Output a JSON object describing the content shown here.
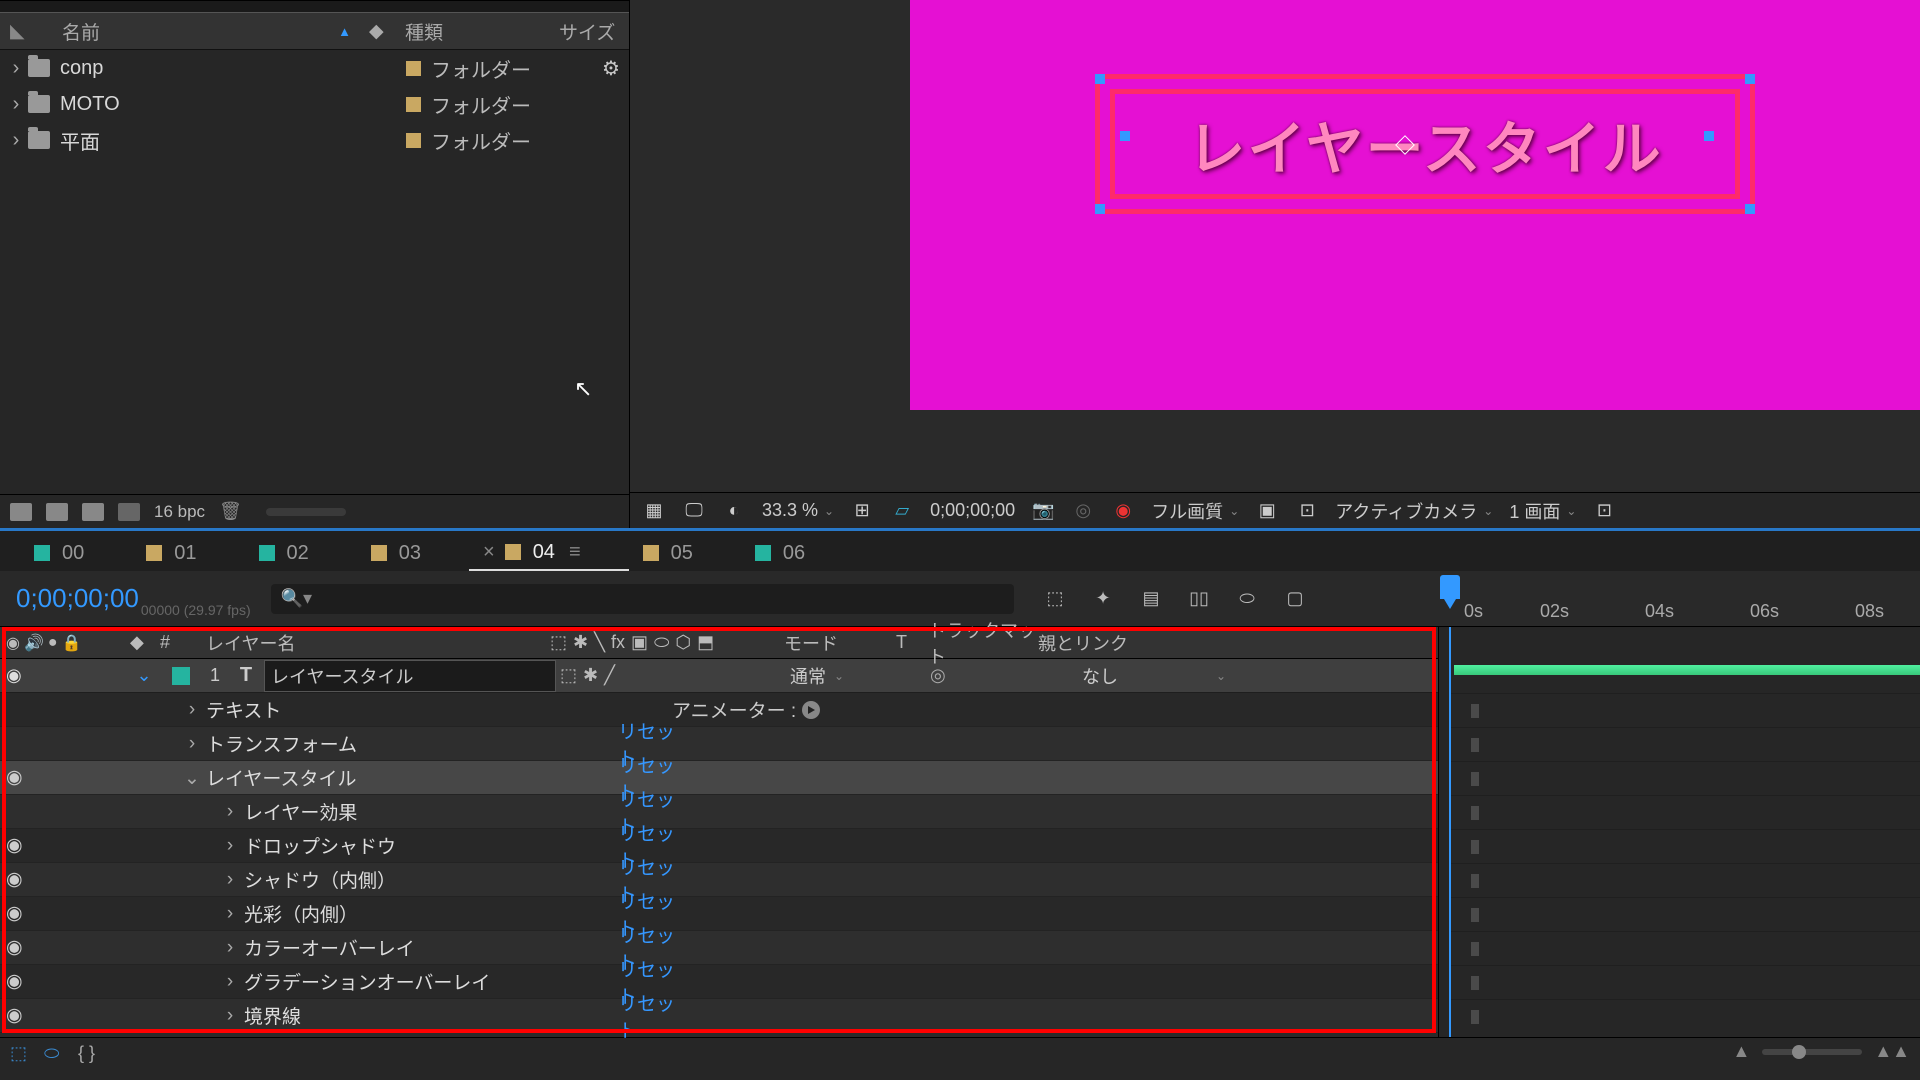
{
  "project": {
    "columns": {
      "name": "名前",
      "type": "種類",
      "size": "サイズ"
    },
    "items": [
      {
        "name": "conp",
        "type": "フォルダー",
        "label": "#c9a862",
        "flow": true
      },
      {
        "name": "MOTO",
        "type": "フォルダー",
        "label": "#c9a862",
        "flow": false
      },
      {
        "name": "平面",
        "type": "フォルダー",
        "label": "#c9a862",
        "flow": false
      }
    ],
    "bpc": "16 bpc"
  },
  "viewer": {
    "text": "レイヤースタイル",
    "zoom": "33.3 %",
    "timecode": "0;00;00;00",
    "quality": "フル画質",
    "camera": "アクティブカメラ",
    "views": "1 画面"
  },
  "tabs": [
    {
      "label": "00",
      "color": "#25b4a0"
    },
    {
      "label": "01",
      "color": "#c9a862"
    },
    {
      "label": "02",
      "color": "#25b4a0"
    },
    {
      "label": "03",
      "color": "#c9a862"
    },
    {
      "label": "04",
      "color": "#c9a862",
      "active": true
    },
    {
      "label": "05",
      "color": "#c9a862"
    },
    {
      "label": "06",
      "color": "#25b4a0"
    }
  ],
  "timeline": {
    "timecode": "0;00;00;00",
    "fps": "00000 (29.97 fps)",
    "ticks": [
      "0s",
      "02s",
      "04s",
      "06s",
      "08s"
    ],
    "columns": {
      "layer_name": "レイヤー名",
      "mode": "モード",
      "track": "トラックマット",
      "parent": "親とリンク",
      "num": "#"
    },
    "layer": {
      "num": "1",
      "name": "レイヤースタイル",
      "label": "#25b4a0",
      "mode": "通常",
      "parent": "なし",
      "type_icon": "T"
    },
    "props": {
      "text": "テキスト",
      "animator": "アニメーター :",
      "transform": "トランスフォーム",
      "layer_style": "レイヤースタイル",
      "reset": "リセット",
      "children": [
        "レイヤー効果",
        "ドロップシャドウ",
        "シャドウ（内側）",
        "光彩（内側）",
        "カラーオーバーレイ",
        "グラデーションオーバーレイ",
        "境界線"
      ]
    }
  }
}
